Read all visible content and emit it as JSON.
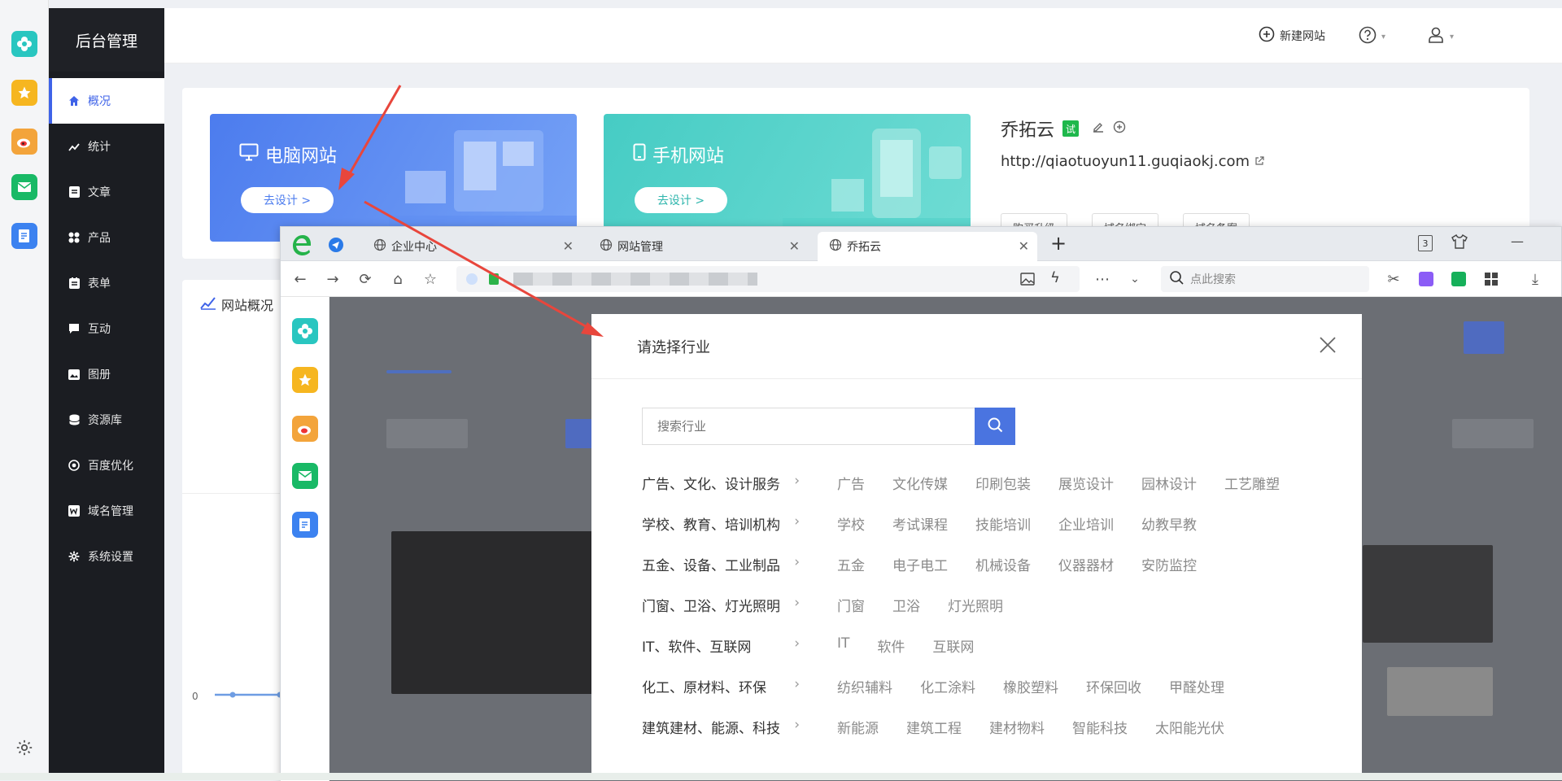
{
  "dock": {
    "icons": [
      "app-plus-icon",
      "star-icon",
      "weibo-icon",
      "mail-icon",
      "doc-edit-icon"
    ],
    "settings_icon": "gear-icon"
  },
  "sidebar": {
    "title": "后台管理",
    "items": [
      {
        "label": "概况",
        "icon": "home-icon",
        "active": true
      },
      {
        "label": "统计",
        "icon": "chart-icon"
      },
      {
        "label": "文章",
        "icon": "article-icon"
      },
      {
        "label": "产品",
        "icon": "grid-icon"
      },
      {
        "label": "表单",
        "icon": "form-icon"
      },
      {
        "label": "互动",
        "icon": "chat-icon"
      },
      {
        "label": "图册",
        "icon": "album-icon"
      },
      {
        "label": "资源库",
        "icon": "database-icon"
      },
      {
        "label": "百度优化",
        "icon": "target-icon"
      },
      {
        "label": "域名管理",
        "icon": "w-icon"
      },
      {
        "label": "系统设置",
        "icon": "gear-icon"
      }
    ]
  },
  "header": {
    "new_site": "新建网站"
  },
  "site_cards": [
    {
      "title": "电脑网站",
      "button": "去设计 >",
      "icon": "monitor-icon",
      "color": "#5b86f0"
    },
    {
      "title": "手机网站",
      "button": "去设计 >",
      "icon": "phone-icon",
      "color": "#4fd0c8"
    }
  ],
  "site_info": {
    "name": "乔拓云",
    "badge": "试",
    "url": "http://qiaotuoyun11.guqiaokj.com",
    "buttons": [
      "购买升级",
      "域名绑定",
      "域名备案"
    ]
  },
  "overview": {
    "title": "网站概况",
    "axis_zero": "0"
  },
  "browser": {
    "tabs": [
      {
        "label": "企业中心",
        "active": false
      },
      {
        "label": "网站管理",
        "active": false
      },
      {
        "label": "乔拓云",
        "active": true
      }
    ],
    "new_tab": "+",
    "tab_count": "3",
    "search_placeholder": "点此搜索"
  },
  "modal": {
    "title": "请选择行业",
    "search_placeholder": "搜索行业",
    "industries": [
      {
        "category": "广告、文化、设计服务",
        "subs": [
          "广告",
          "文化传媒",
          "印刷包装",
          "展览设计",
          "园林设计",
          "工艺雕塑"
        ]
      },
      {
        "category": "学校、教育、培训机构",
        "subs": [
          "学校",
          "考试课程",
          "技能培训",
          "企业培训",
          "幼教早教"
        ]
      },
      {
        "category": "五金、设备、工业制品",
        "subs": [
          "五金",
          "电子电工",
          "机械设备",
          "仪器器材",
          "安防监控"
        ]
      },
      {
        "category": "门窗、卫浴、灯光照明",
        "subs": [
          "门窗",
          "卫浴",
          "灯光照明"
        ]
      },
      {
        "category": "IT、软件、互联网",
        "subs": [
          "IT",
          "软件",
          "互联网"
        ]
      },
      {
        "category": "化工、原材料、环保",
        "subs": [
          "纺织辅料",
          "化工涂料",
          "橡胶塑料",
          "环保回收",
          "甲醛处理"
        ]
      },
      {
        "category": "建筑建材、能源、科技",
        "subs": [
          "新能源",
          "建筑工程",
          "建材物料",
          "智能科技",
          "太阳能光伏"
        ]
      }
    ]
  },
  "colors": {
    "accent": "#3f63e8",
    "sidebar_bg": "#1b1d22",
    "arrow": "#e8463c"
  }
}
